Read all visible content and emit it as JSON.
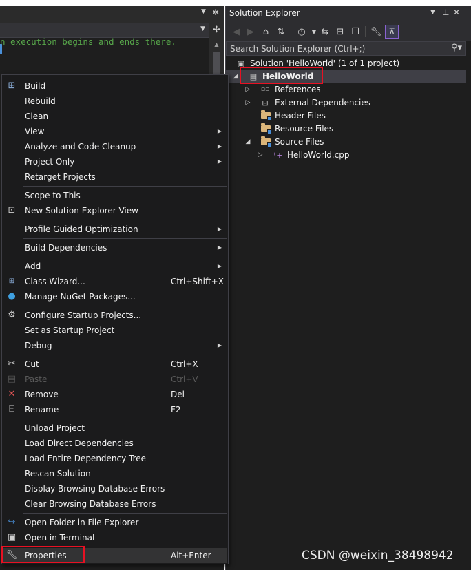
{
  "editor": {
    "code_line": "n execution begins and ends there.",
    "split_icon": "split-icon"
  },
  "context_menu": {
    "items": [
      {
        "id": "build",
        "label": "Build",
        "icon": "build-icon"
      },
      {
        "id": "rebuild",
        "label": "Rebuild"
      },
      {
        "id": "clean",
        "label": "Clean"
      },
      {
        "id": "view",
        "label": "View",
        "submenu": true
      },
      {
        "id": "analyze",
        "label": "Analyze and Code Cleanup",
        "submenu": true
      },
      {
        "id": "project-only",
        "label": "Project Only",
        "submenu": true
      },
      {
        "id": "retarget",
        "label": "Retarget Projects"
      },
      {
        "id": "scope",
        "label": "Scope to This"
      },
      {
        "id": "new-se-view",
        "label": "New Solution Explorer View",
        "icon": "new-view-icon"
      },
      {
        "id": "pgo",
        "label": "Profile Guided Optimization",
        "submenu": true
      },
      {
        "id": "build-deps",
        "label": "Build Dependencies",
        "submenu": true
      },
      {
        "id": "add",
        "label": "Add",
        "submenu": true
      },
      {
        "id": "class-wizard",
        "label": "Class Wizard...",
        "shortcut": "Ctrl+Shift+X",
        "icon": "class-wizard-icon"
      },
      {
        "id": "nuget",
        "label": "Manage NuGet Packages...",
        "icon": "nuget-icon"
      },
      {
        "id": "startup-projects",
        "label": "Configure Startup Projects...",
        "icon": "gear-icon"
      },
      {
        "id": "set-startup",
        "label": "Set as Startup Project"
      },
      {
        "id": "debug",
        "label": "Debug",
        "submenu": true
      },
      {
        "id": "cut",
        "label": "Cut",
        "shortcut": "Ctrl+X",
        "icon": "scissors-icon"
      },
      {
        "id": "paste",
        "label": "Paste",
        "shortcut": "Ctrl+V",
        "icon": "paste-icon",
        "disabled": true
      },
      {
        "id": "remove",
        "label": "Remove",
        "shortcut": "Del",
        "icon": "remove-x-icon"
      },
      {
        "id": "rename",
        "label": "Rename",
        "shortcut": "F2",
        "icon": "rename-icon"
      },
      {
        "id": "unload",
        "label": "Unload Project"
      },
      {
        "id": "load-direct",
        "label": "Load Direct Dependencies"
      },
      {
        "id": "load-tree",
        "label": "Load Entire Dependency Tree"
      },
      {
        "id": "rescan",
        "label": "Rescan Solution"
      },
      {
        "id": "display-errors",
        "label": "Display Browsing Database Errors"
      },
      {
        "id": "clear-errors",
        "label": "Clear Browsing Database Errors"
      },
      {
        "id": "open-folder",
        "label": "Open Folder in File Explorer",
        "icon": "open-folder-icon"
      },
      {
        "id": "open-terminal",
        "label": "Open in Terminal",
        "icon": "terminal-icon"
      },
      {
        "id": "properties",
        "label": "Properties",
        "shortcut": "Alt+Enter",
        "icon": "wrench-icon"
      }
    ]
  },
  "solution_explorer": {
    "title": "Solution Explorer",
    "search_placeholder": "Search Solution Explorer (Ctrl+;)",
    "solution_label": "Solution 'HelloWorld' (1 of 1 project)",
    "project_label": "HelloWorld",
    "nodes": {
      "references": "References",
      "external_deps": "External Dependencies",
      "header_files": "Header Files",
      "resource_files": "Resource Files",
      "source_files": "Source Files",
      "helloworld_cpp": "HelloWorld.cpp"
    }
  },
  "colors": {
    "highlight_box": "#e81123",
    "comment_green": "#57a64a",
    "accent_purple": "#8a63d2"
  },
  "watermark": "CSDN @weixin_38498942"
}
